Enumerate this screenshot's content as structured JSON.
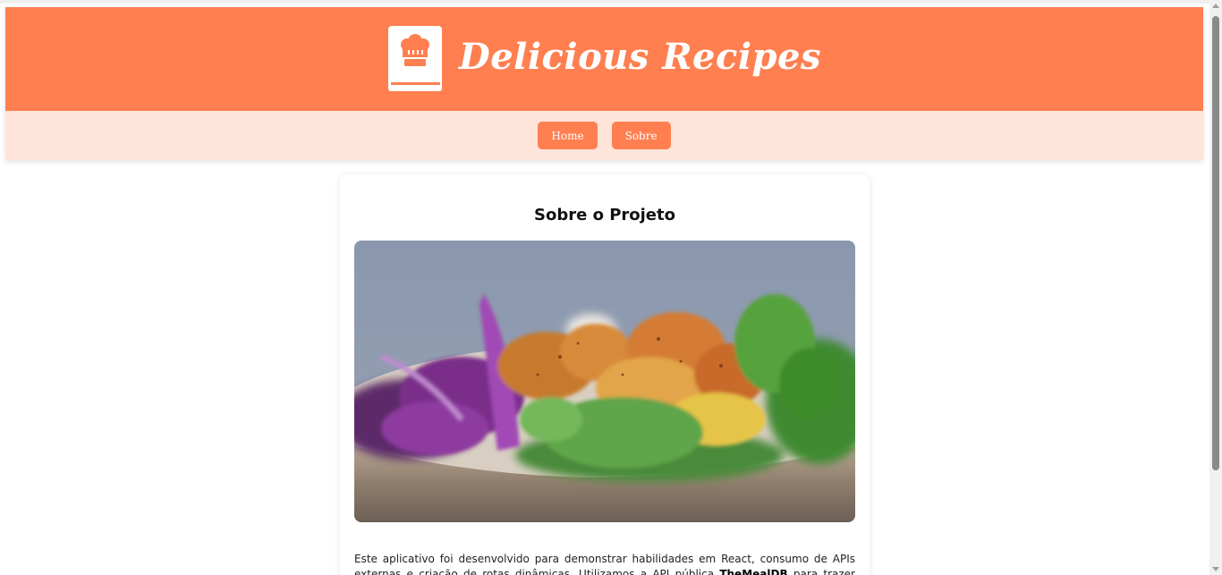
{
  "header": {
    "title": "Delicious Recipes",
    "logo_icon": "chef-hat-book-icon"
  },
  "nav": {
    "items": [
      {
        "label": "Home"
      },
      {
        "label": "Sobre"
      }
    ]
  },
  "about": {
    "title": "Sobre o Projeto",
    "image_alt": "salad-bowl-photo",
    "description_part1": "Este aplicativo foi desenvolvido para demonstrar habilidades em React, consumo de APIs externas e criação de rotas dinâmicas. Utilizamos a API pública ",
    "description_bold": "TheMealDB",
    "description_part2": " para trazer receitas incríveis do"
  },
  "colors": {
    "primary": "#ff7f50",
    "nav_bg": "#ffe4d9",
    "text": "#111111"
  }
}
